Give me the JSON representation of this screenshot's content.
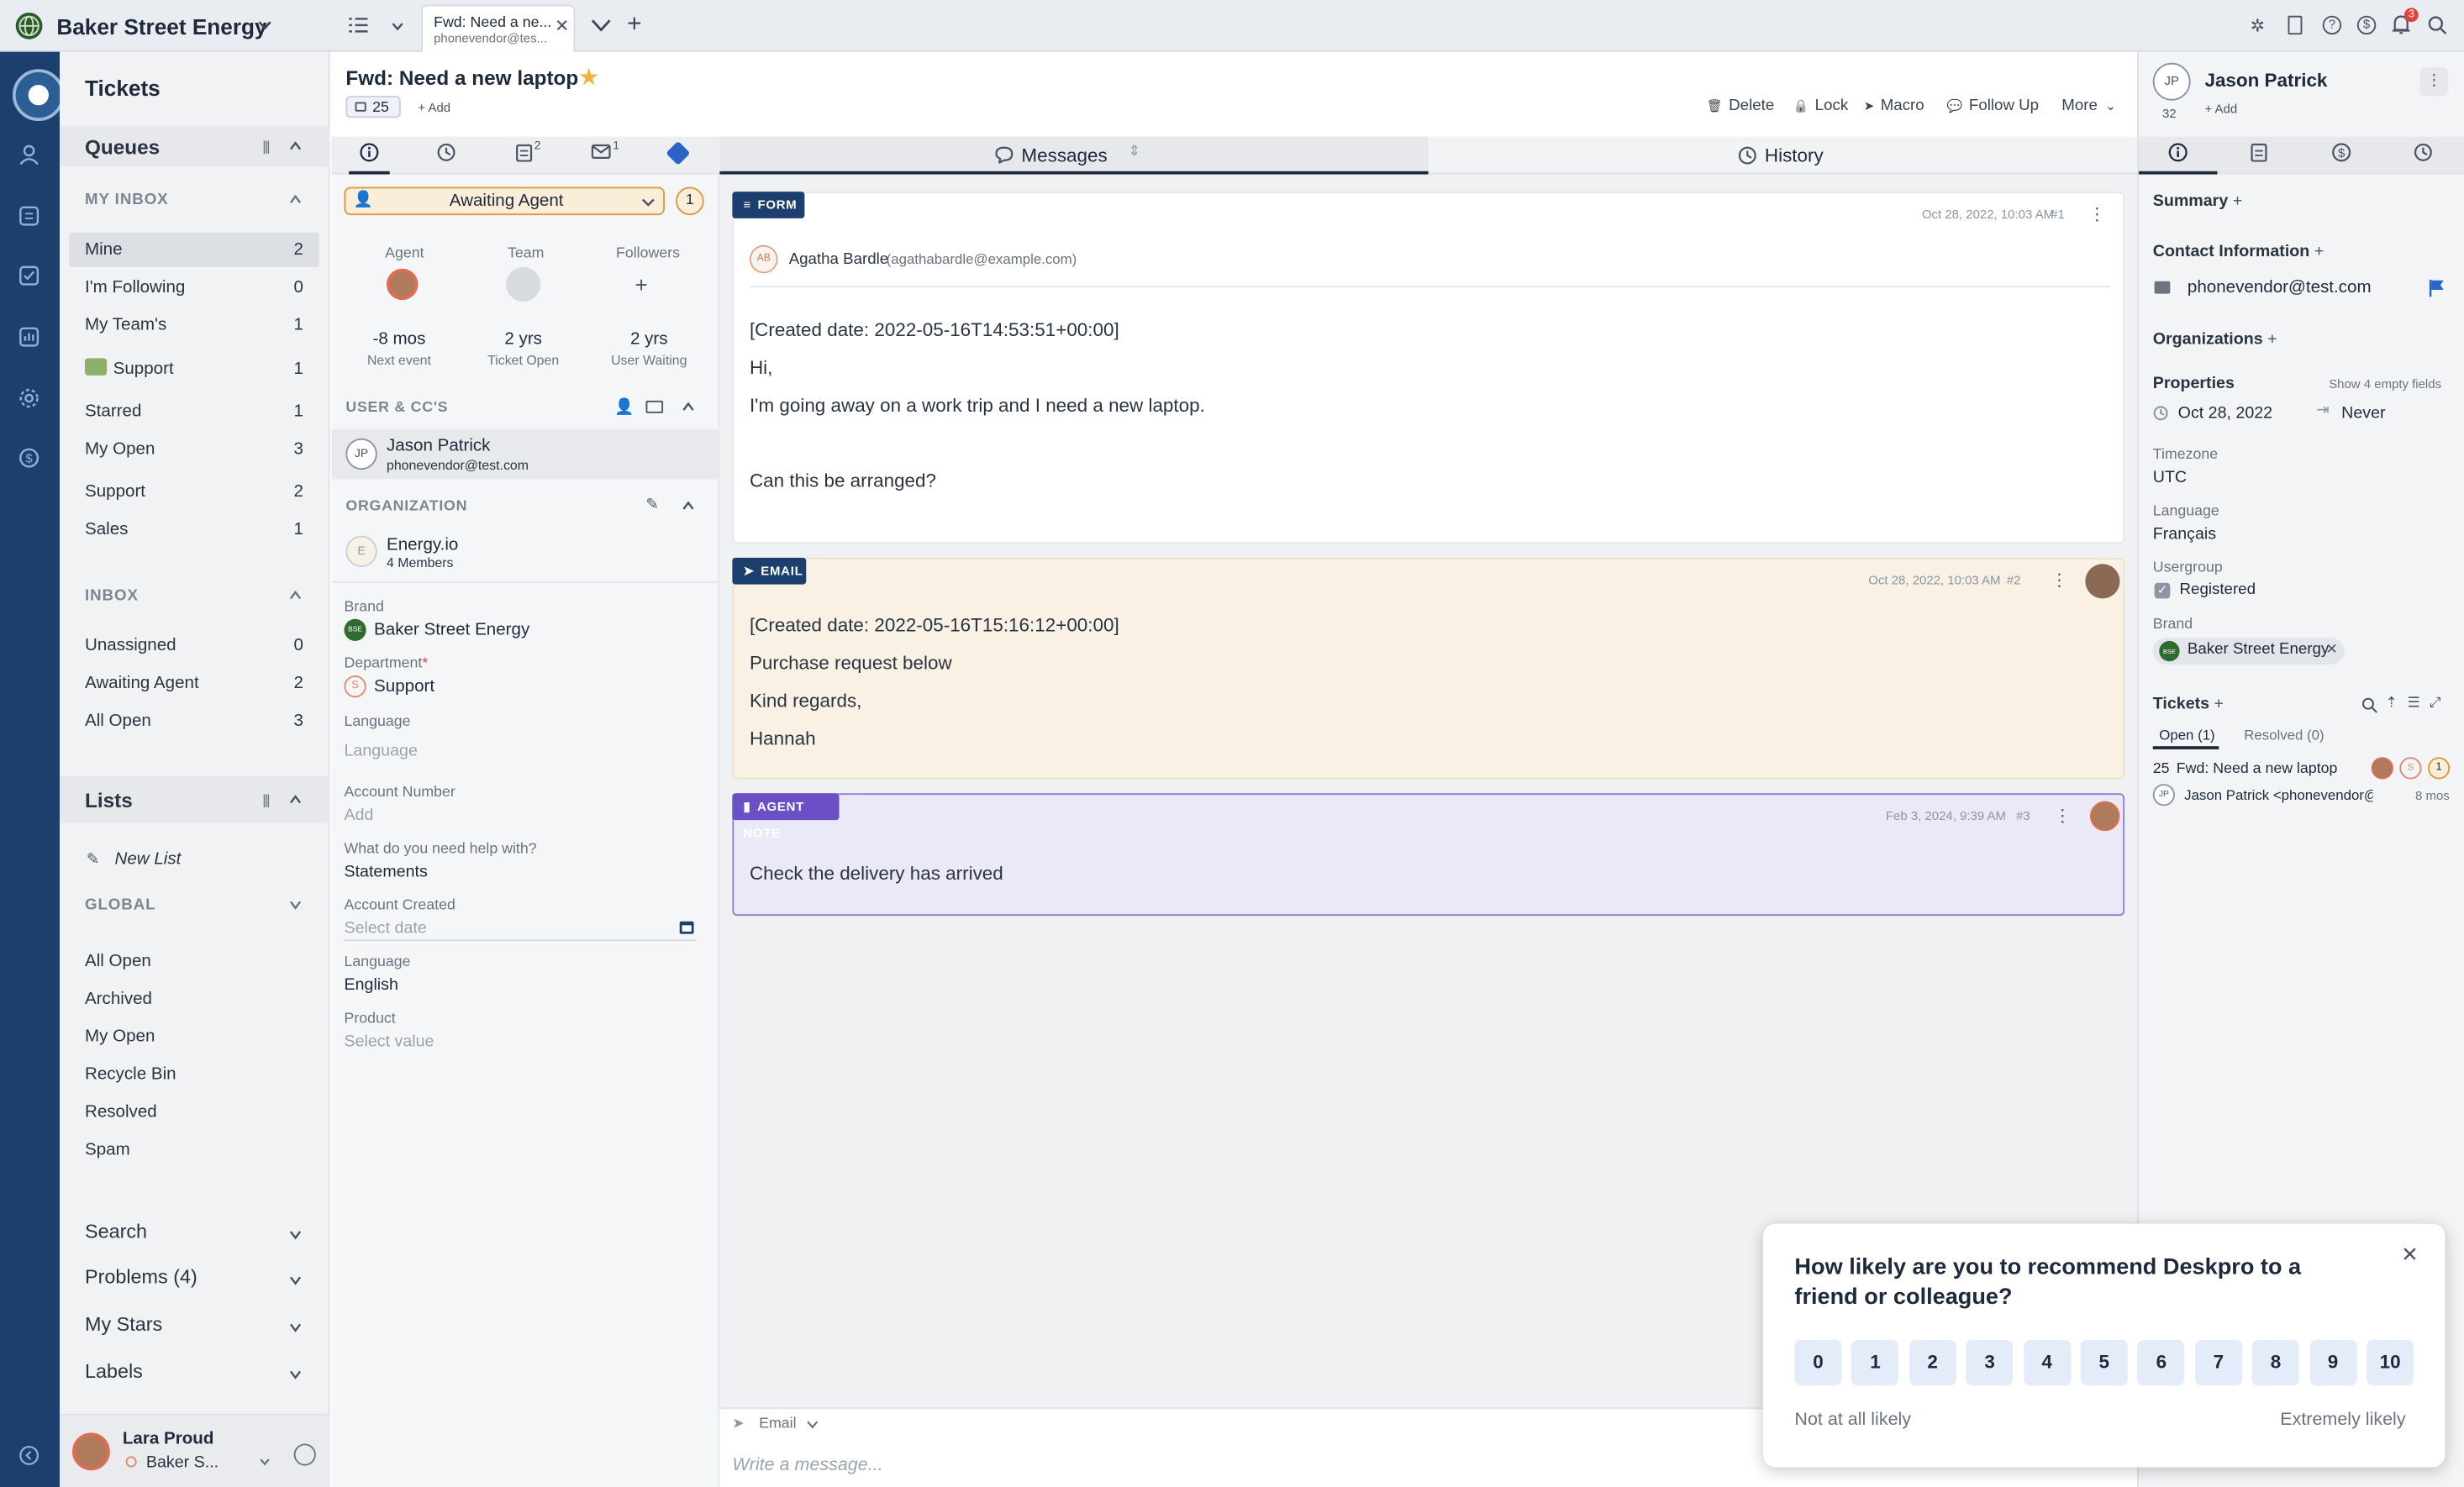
{
  "header": {
    "brand": "Baker Street Energy",
    "tab_title": "Fwd: Need a ne...",
    "tab_sub": "phonevendor@tes...",
    "notif_count": "3"
  },
  "sidebar": {
    "title": "Tickets",
    "queues": "Queues",
    "my_inbox": "MY INBOX",
    "my_inbox_items": [
      {
        "label": "Mine",
        "count": "2"
      },
      {
        "label": "I'm Following",
        "count": "0"
      },
      {
        "label": "My Team's",
        "count": "1"
      },
      {
        "label": "Support",
        "count": "1"
      },
      {
        "label": "Starred",
        "count": "1"
      },
      {
        "label": "My Open",
        "count": "3"
      },
      {
        "label": "Support",
        "count": "2"
      },
      {
        "label": "Sales",
        "count": "1"
      }
    ],
    "inbox": "INBOX",
    "inbox_items": [
      {
        "label": "Unassigned",
        "count": "0"
      },
      {
        "label": "Awaiting Agent",
        "count": "2"
      },
      {
        "label": "All Open",
        "count": "3"
      }
    ],
    "lists": "Lists",
    "new_list": "New List",
    "global": "GLOBAL",
    "global_items": [
      "All Open",
      "Archived",
      "My Open",
      "Recycle Bin",
      "Resolved",
      "Spam"
    ],
    "sections": [
      "Search",
      "Problems (4)",
      "My Stars",
      "Labels"
    ],
    "user_name": "Lara Proud",
    "user_brand": "Baker S..."
  },
  "ticket": {
    "subject": "Fwd: Need a new laptop",
    "id_badge": "25",
    "add_label": "+ Add",
    "actions": [
      "Delete",
      "Lock",
      "Macro",
      "Follow Up",
      "More"
    ],
    "tab_counts": {
      "tasks": "2",
      "mail": "1"
    },
    "status": "Awaiting Agent",
    "status_count": "1",
    "agent_label": "Agent",
    "team_label": "Team",
    "followers_label": "Followers",
    "stats": [
      {
        "v": "-8 mos",
        "l": "Next event"
      },
      {
        "v": "2 yrs",
        "l": "Ticket Open"
      },
      {
        "v": "2 yrs",
        "l": "User Waiting"
      }
    ],
    "users_heading": "USER & CC'S",
    "user_initials": "JP",
    "user_name": "Jason Patrick",
    "user_email": "phonevendor@test.com",
    "org_heading": "ORGANIZATION",
    "org_initial": "E",
    "org_name": "Energy.io",
    "org_members": "4 Members",
    "fields": {
      "brand_l": "Brand",
      "brand_badge": "BSE",
      "brand_v": "Baker Street Energy",
      "dept_l": "Department",
      "dept_req": "*",
      "dept_initial": "S",
      "dept_v": "Support",
      "lang_l": "Language",
      "lang_v": "Language",
      "acct_l": "Account Number",
      "acct_v": "Add",
      "help_l": "What do you need help with?",
      "help_v": "Statements",
      "created_l": "Account Created",
      "created_v": "Select date",
      "lang2_l": "Language",
      "lang2_v": "English",
      "product_l": "Product",
      "product_v": "Select value"
    }
  },
  "center": {
    "messages_tab": "Messages",
    "history_tab": "History",
    "msg1": {
      "tag": "FORM",
      "date": "Oct 28, 2022, 10:03 AM",
      "num": "#1",
      "initials": "AB",
      "author": "Agatha Bardle",
      "email": "(agathabardle@example.com)",
      "lines": [
        "[Created date: 2022-05-16T14:53:51+00:00]",
        "Hi,",
        "I'm going away on a work trip and I need a new laptop.",
        "Can this be arranged?"
      ]
    },
    "msg2": {
      "tag": "EMAIL",
      "date": "Oct 28, 2022, 10:03 AM",
      "num": "#2",
      "lines": [
        "[Created date: 2022-05-16T15:16:12+00:00]",
        "Purchase request below",
        "Kind regards,",
        "Hannah"
      ]
    },
    "msg3": {
      "tag": "AGENT NOTE",
      "date": "Feb 3, 2024, 9:39 AM",
      "num": "#3",
      "lines": [
        "Check the delivery has arrived"
      ]
    },
    "composer_type": "Email",
    "composer_placeholder": "Write a message..."
  },
  "right": {
    "initials": "JP",
    "name": "Jason Patrick",
    "id": "32",
    "add": "+ Add",
    "summary": "Summary",
    "contact": "Contact Information",
    "email": "phonevendor@test.com",
    "orgs": "Organizations",
    "properties": "Properties",
    "show_empty": "Show 4 empty fields",
    "date": "Oct 28, 2022",
    "never": "Never",
    "tz_l": "Timezone",
    "tz_v": "UTC",
    "lang_l": "Language",
    "lang_v": "Français",
    "ug_l": "Usergroup",
    "ug_v": "Registered",
    "brand_l": "Brand",
    "brand_badge": "BSE",
    "brand_v": "Baker Street Energy",
    "tickets": "Tickets",
    "open_tab": "Open (1)",
    "resolved_tab": "Resolved (0)",
    "t_id": "25",
    "t_subject": "Fwd: Need a new laptop",
    "t_user_initials": "JP",
    "t_user": "Jason Patrick <phonevendor@tes...",
    "t_age": "8 mos",
    "t_badge": "1",
    "t_dept": "S"
  },
  "nps": {
    "question": "How likely are you to recommend Deskpro to a friend or colleague?",
    "scores": [
      "0",
      "1",
      "2",
      "3",
      "4",
      "5",
      "6",
      "7",
      "8",
      "9",
      "10"
    ],
    "low": "Not at all likely",
    "high": "Extremely likely"
  }
}
